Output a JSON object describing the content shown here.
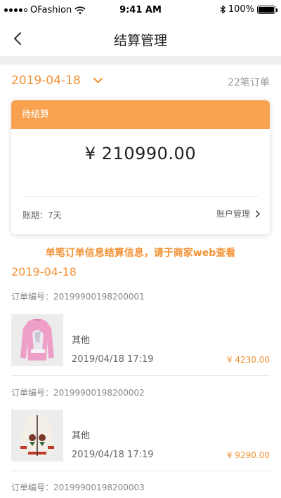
{
  "status_bar": {
    "carrier": "OFashion",
    "time": "9:41 AM",
    "battery": "100%"
  },
  "nav": {
    "title": "结算管理"
  },
  "filter": {
    "date": "2019-04-18",
    "order_count": "22笔订单"
  },
  "summary_card": {
    "status": "待结算",
    "amount": "¥ 210990.00",
    "period": "账期：7天",
    "account_link": "账户管理"
  },
  "notice": "单笔订单信息结算信息，请于商家web查看",
  "section_date": "2019-04-18",
  "orders": [
    {
      "order_no": "订单编号：20199900198200001",
      "category": "其他",
      "time": "2019/04/18 17:19",
      "price": "¥ 4230.00"
    },
    {
      "order_no": "订单编号：20199900198200002",
      "category": "其他",
      "time": "2019/04/18 17:19",
      "price": "¥ 9290.00"
    },
    {
      "order_no": "订单编号：20199900198200003"
    }
  ],
  "colors": {
    "accent": "#f39236",
    "card_header": "#f8a24f",
    "band": "#efeff2"
  }
}
